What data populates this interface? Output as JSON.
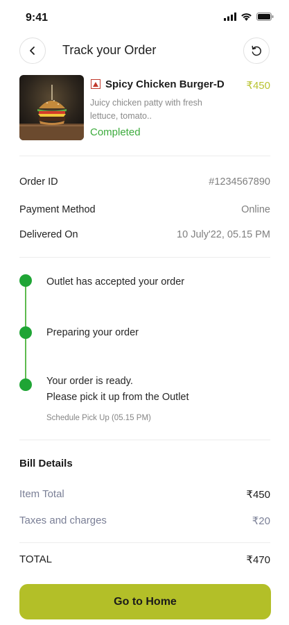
{
  "status_bar": {
    "time": "9:41"
  },
  "header": {
    "title": "Track your Order"
  },
  "product": {
    "name": "Spicy Chicken Burger-D",
    "price": "₹450",
    "description": "Juicy chicken patty with fresh lettuce, tomato..",
    "status": "Completed"
  },
  "order_info": [
    {
      "label": "Order ID",
      "value": "#1234567890"
    },
    {
      "label": "Payment Method",
      "value": "Online"
    },
    {
      "label": "Delivered On",
      "value": "10 July'22, 05.15 PM"
    }
  ],
  "timeline": [
    {
      "text": "Outlet has accepted your order"
    },
    {
      "text": "Preparing your order"
    },
    {
      "text": "Your order is ready.",
      "text2": "Please pick it up from the Outlet",
      "sub": "Schedule Pick Up (05.15 PM)"
    }
  ],
  "bill": {
    "title": "Bill Details",
    "item_total_label": "Item Total",
    "item_total_value": "₹450",
    "taxes_label": "Taxes and charges",
    "taxes_value": "₹20",
    "total_label": "TOTAL",
    "total_value": "₹470"
  },
  "home_button": {
    "label": "Go to Home"
  },
  "colors": {
    "accent": "#b3bf28",
    "success": "#3cab3c",
    "timeline": "#1fa535"
  }
}
